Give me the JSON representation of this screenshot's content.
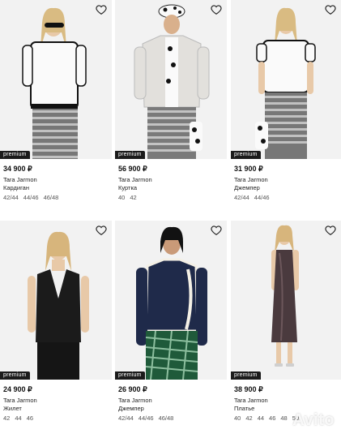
{
  "badge_label": "premium",
  "products": [
    {
      "price": "34 900 ₽",
      "brand": "Tara Jarmon",
      "type": "Кардиган",
      "sizes": [
        "42/44",
        "44/46",
        "46/48"
      ]
    },
    {
      "price": "56 900 ₽",
      "brand": "Tara Jarmon",
      "type": "Куртка",
      "sizes": [
        "40",
        "42"
      ]
    },
    {
      "price": "31 900 ₽",
      "brand": "Tara Jarmon",
      "type": "Джемпер",
      "sizes": [
        "42/44",
        "44/46"
      ]
    },
    {
      "price": "24 900 ₽",
      "brand": "Tara Jarmon",
      "type": "Жилет",
      "sizes": [
        "42",
        "44",
        "46"
      ]
    },
    {
      "price": "26 900 ₽",
      "brand": "Tara Jarmon",
      "type": "Джемпер",
      "sizes": [
        "42/44",
        "44/46",
        "46/48"
      ]
    },
    {
      "price": "38 900 ₽",
      "brand": "Tara Jarmon",
      "type": "Платье",
      "sizes": [
        "40",
        "42",
        "44",
        "46",
        "48",
        "50"
      ]
    }
  ],
  "watermark": "Avito",
  "icons": {
    "favorite": "heart-outline-icon"
  }
}
